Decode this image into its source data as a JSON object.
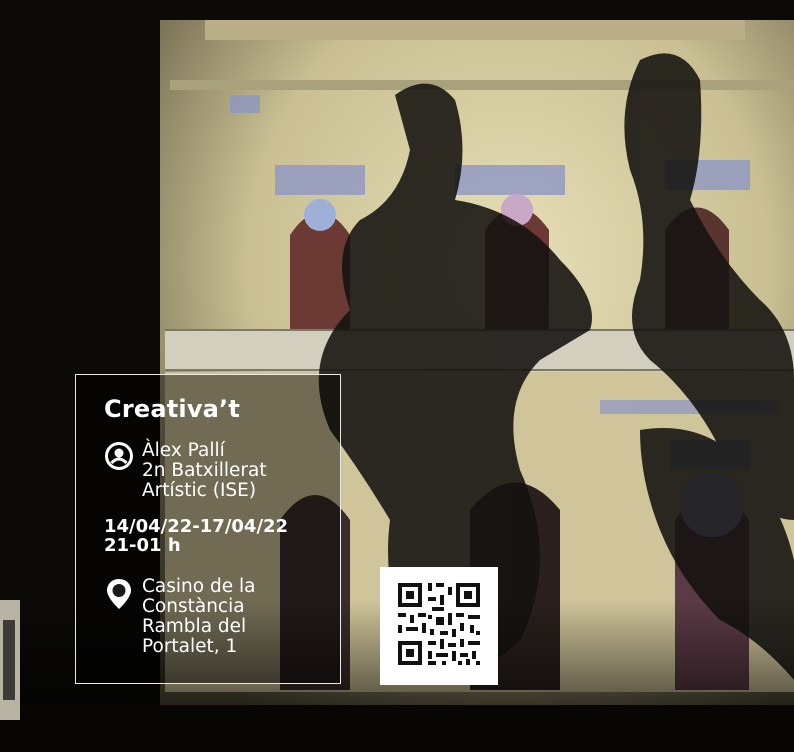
{
  "event": {
    "title": "Creativa’t",
    "artist_lines": [
      "Àlex Pallí",
      "2n Batxillerat",
      "Artístic (ISE)"
    ],
    "date_lines": [
      "14/04/22-17/04/22",
      "21-01 h"
    ],
    "venue_lines": [
      "Casino de la",
      "Constància",
      "Rambla del",
      "Portalet, 1"
    ]
  },
  "icons": {
    "person": "user-circle-icon",
    "location": "location-pin-icon",
    "qr": "qr-code"
  },
  "colors": {
    "text": "#ffffff",
    "box_border": "#e8e8e8",
    "facade": "#d8cfa6",
    "night": "#0b0a08"
  }
}
